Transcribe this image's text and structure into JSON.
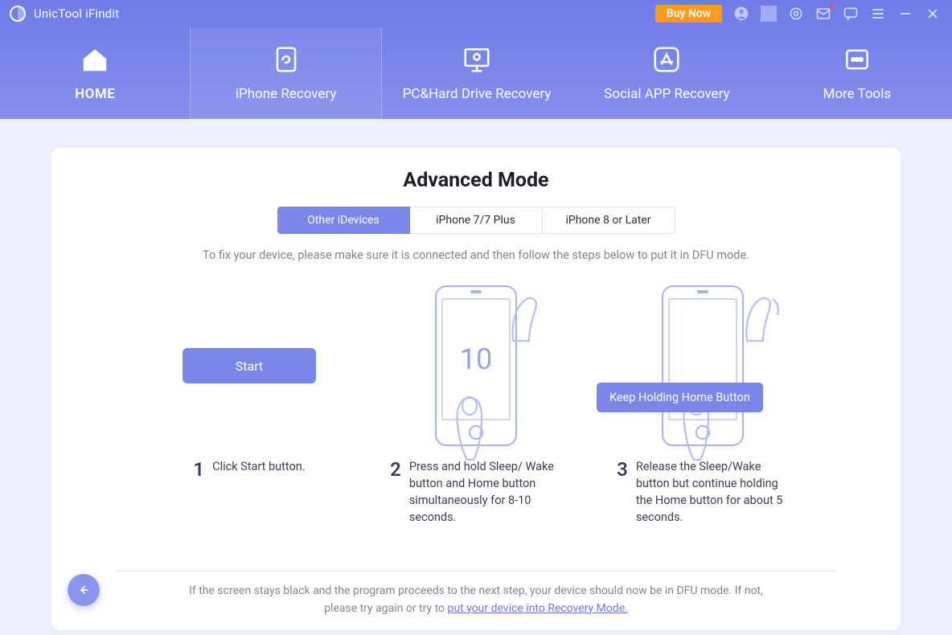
{
  "app": {
    "title": "UnicTool iFindit",
    "buy_now": "Buy Now"
  },
  "nav": {
    "home": "HOME",
    "iphone": "iPhone Recovery",
    "pc": "PC&Hard Drive Recovery",
    "social": "Social APP Recovery",
    "more": "More Tools"
  },
  "page": {
    "title": "Advanced Mode",
    "device_tabs": [
      "Other iDevices",
      "iPhone 7/7 Plus",
      "iPhone 8 or Later"
    ],
    "instruction": "To fix your device, please make sure it is connected and then follow the steps below to put it in DFU mode.",
    "start_label": "Start",
    "hold_label": "Keep Holding Home Button",
    "counter": "10",
    "steps": {
      "s1": {
        "num": "1",
        "text": "Click Start button."
      },
      "s2": {
        "num": "2",
        "text": "Press and hold Sleep/ Wake button and Home button simultaneously for 8-10 seconds."
      },
      "s3": {
        "num": "3",
        "text": "Release the Sleep/Wake button but continue holding the Home button for about 5 seconds."
      }
    },
    "footnote_a": "If the screen stays black and the program proceeds to the next step, your device should now be in DFU mode. If not, please try again or try to ",
    "footnote_link": "put your device into Recovery Mode."
  }
}
